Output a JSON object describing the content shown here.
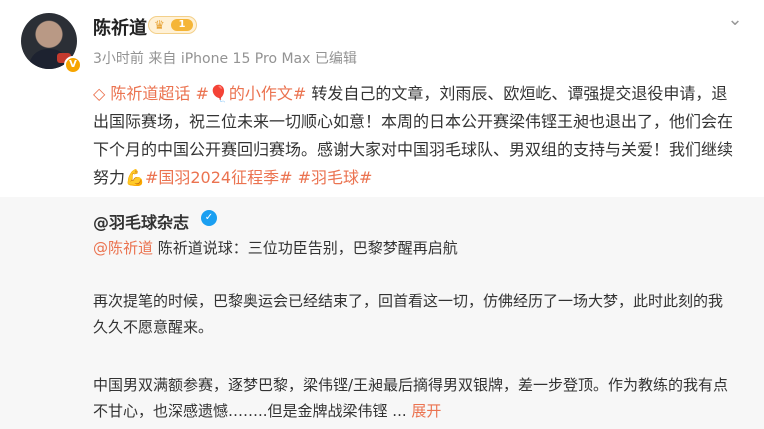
{
  "post": {
    "author": "陈祈道",
    "vip_level": "1",
    "time": "3小时前",
    "source": "来自 iPhone 15 Pro Max",
    "edited": "已编辑",
    "super_topic": "陈祈道超话",
    "topic_tag": "#🎈的小作文#",
    "text_part1": "转发自己的文章，刘雨辰、欧烜屹、谭强提交退役申请，退出国际赛场，祝三位未来一切顺心如意！本周的日本公开赛梁伟铿王昶也退出了，他们会在下个月的中国公开赛回归赛场。感谢大家对中国羽毛球队、男双组的支持与关爱！我们继续努力",
    "hashtag1": "#国羽2024征程季#",
    "hashtag2": "#羽毛球#"
  },
  "repost": {
    "author": "@羽毛球杂志",
    "mention": "@陈祈道",
    "subtitle": "陈祈道说球：三位功臣告别，巴黎梦醒再启航",
    "para1": "再次提笔的时候，巴黎奥运会已经结束了，回首看这一切，仿佛经历了一场大梦，此时此刻的我久久不愿意醒来。",
    "para2": "中国男双满额参赛，逐梦巴黎，梁伟铿/王昶最后摘得男双银牌，差一步登顶。作为教练的我有点不甘心，也深感遗憾……..但是金牌战梁伟铿 ...",
    "expand_label": "展开"
  }
}
